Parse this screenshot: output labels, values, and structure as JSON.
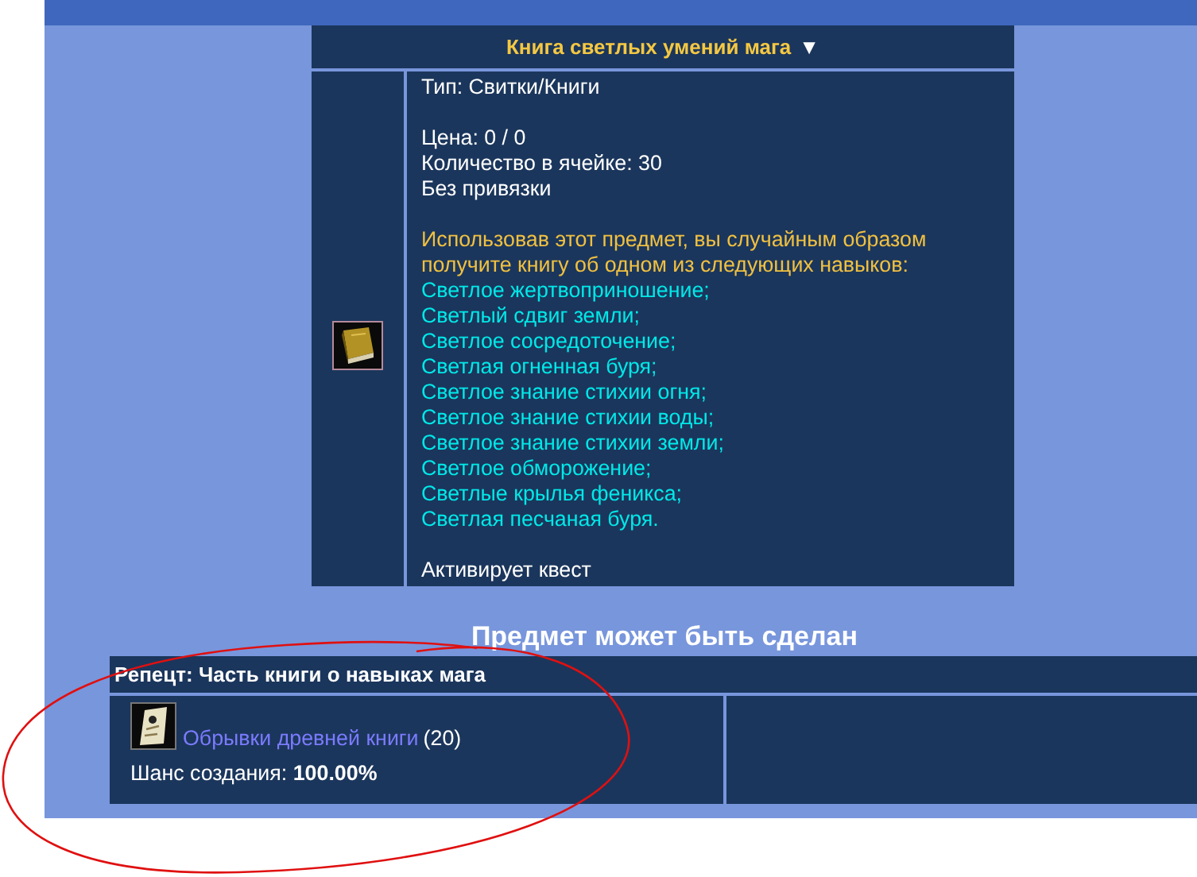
{
  "item": {
    "title": "Книга светлых умений мага",
    "toggle": "▼",
    "sections": [
      [
        {
          "kind": "plain",
          "text": "Тип: Свитки/Книги"
        }
      ],
      [
        {
          "kind": "plain",
          "text": "Цена: 0 / 0"
        },
        {
          "kind": "plain",
          "text": "Количество в ячейке: 30"
        },
        {
          "kind": "plain",
          "text": "Без привязки"
        }
      ],
      [
        {
          "kind": "description",
          "text": "Использовав этот предмет, вы случайным образом получите книгу об одном из следующих навыков:"
        },
        {
          "kind": "skill",
          "text": "Светлое жертвоприношение;"
        },
        {
          "kind": "skill",
          "text": "Светлый сдвиг земли;"
        },
        {
          "kind": "skill",
          "text": "Светлое сосредоточение;"
        },
        {
          "kind": "skill",
          "text": "Светлая огненная буря;"
        },
        {
          "kind": "skill",
          "text": "Светлое знание стихии огня;"
        },
        {
          "kind": "skill",
          "text": "Светлое знание стихии воды;"
        },
        {
          "kind": "skill",
          "text": "Светлое знание стихии земли;"
        },
        {
          "kind": "skill",
          "text": "Светлое обморожение;"
        },
        {
          "kind": "skill",
          "text": "Светлые крылья феникса;"
        },
        {
          "kind": "skill",
          "text": "Светлая песчаная буря."
        }
      ],
      [
        {
          "kind": "plain",
          "text": "Активирует квест"
        }
      ]
    ]
  },
  "crafting": {
    "heading": "Предмет может быть сделан",
    "recipe": {
      "title": "Репецт: Часть книги о навыках мага",
      "ingredient": {
        "name": "Обрывки древней книги",
        "count": "(20)"
      },
      "chance": "Шанс создания: **100.00%**"
    }
  }
}
